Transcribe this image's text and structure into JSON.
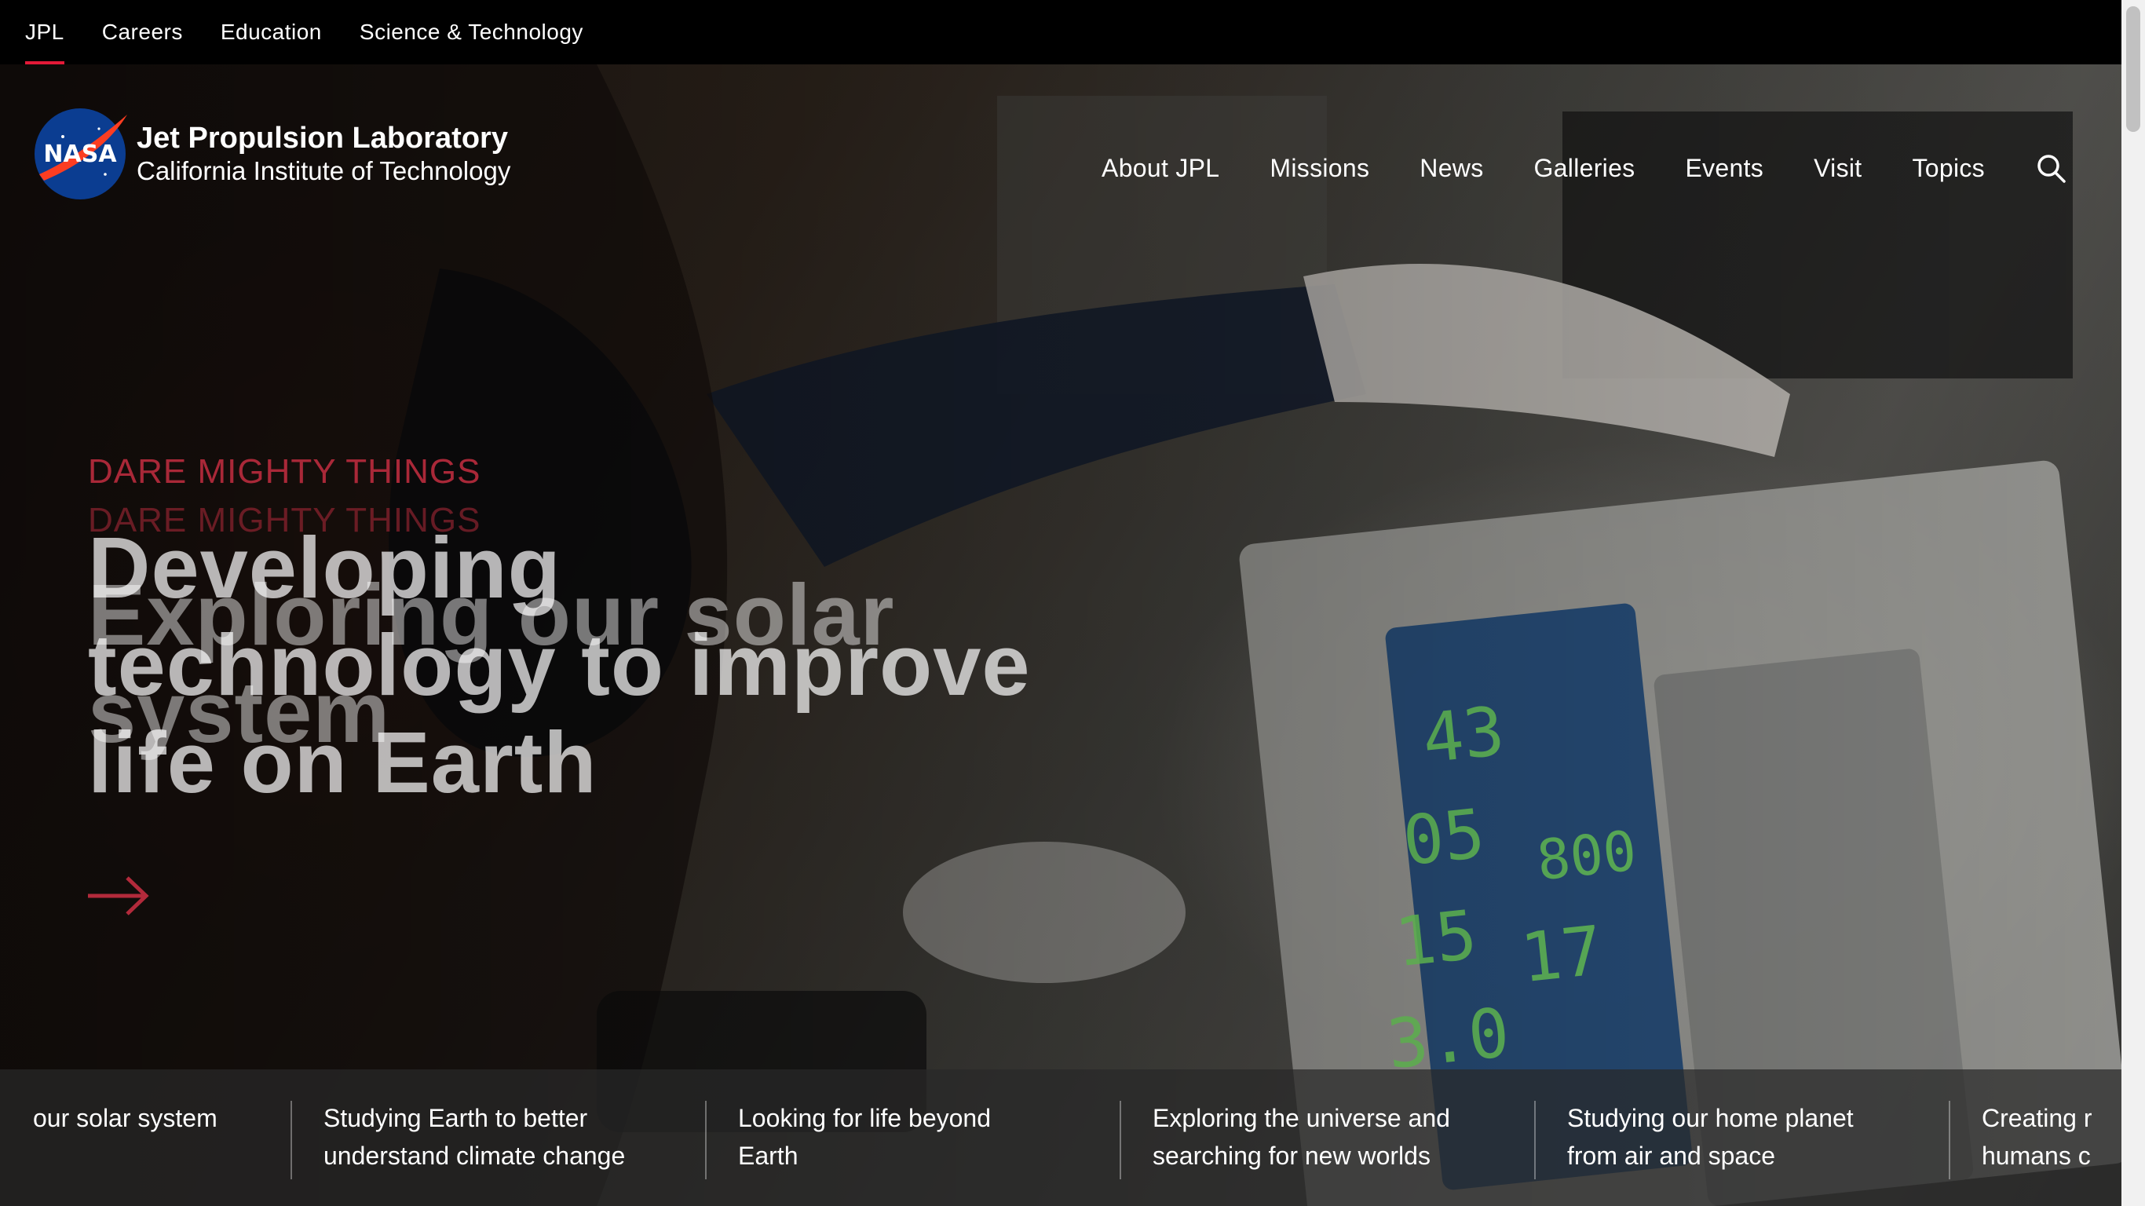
{
  "top_nav": {
    "items": [
      {
        "label": "JPL",
        "active": true
      },
      {
        "label": "Careers",
        "active": false
      },
      {
        "label": "Education",
        "active": false
      },
      {
        "label": "Science & Technology",
        "active": false
      }
    ]
  },
  "brand": {
    "logo_text": "NASA",
    "line1": "Jet Propulsion Laboratory",
    "line2": "California Institute of Technology"
  },
  "main_nav": {
    "items": [
      "About JPL",
      "Missions",
      "News",
      "Galleries",
      "Events",
      "Visit",
      "Topics"
    ],
    "search_icon": "search-icon"
  },
  "hero": {
    "kicker_current": "DARE MIGHTY THINGS",
    "kicker_next": "DARE MIGHTY THINGS",
    "headline_current": [
      "Developing",
      "technology to improve",
      "life on Earth"
    ],
    "headline_next": [
      "Exploring our solar",
      "system"
    ],
    "arrow_icon": "arrow-right-icon",
    "accent_color": "#b22a3b"
  },
  "carousel": {
    "items": [
      [
        "our solar system"
      ],
      [
        "Studying Earth to better",
        "understand climate change"
      ],
      [
        "Looking for life beyond",
        "Earth"
      ],
      [
        "Exploring the universe and",
        "searching for new worlds"
      ],
      [
        "Studying our home planet",
        "from air and space"
      ],
      [
        "Creating r",
        "humans c"
      ]
    ]
  }
}
